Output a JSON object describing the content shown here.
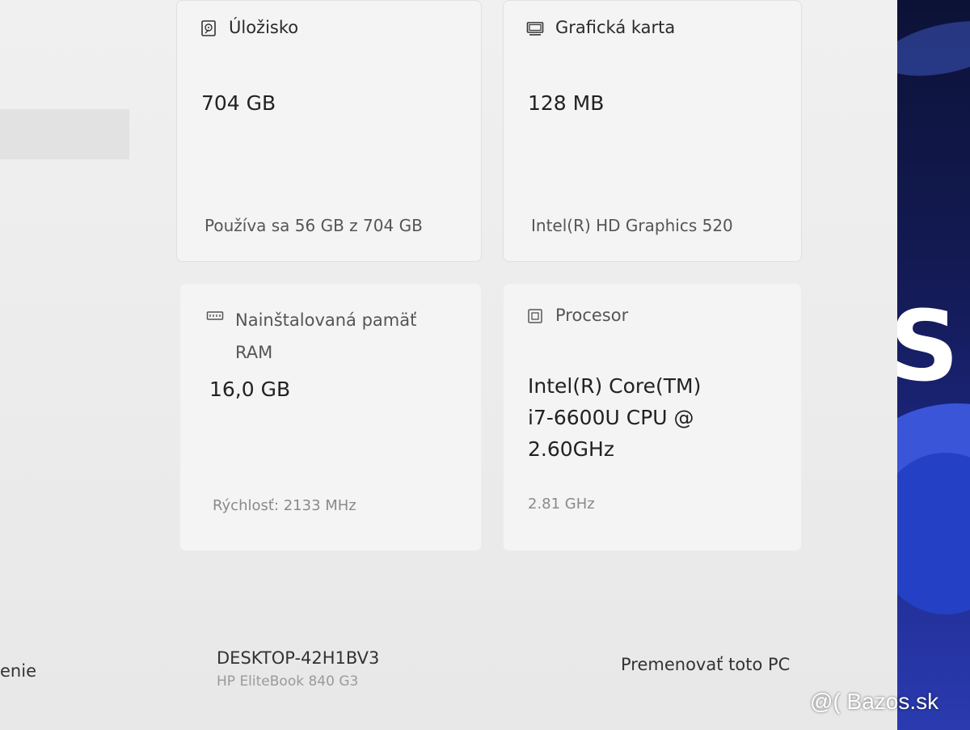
{
  "sidebar": {
    "item_partial_label": "enie"
  },
  "cards": {
    "storage": {
      "icon": "hard-drive-icon",
      "title": "Úložisko",
      "value": "704 GB",
      "detail": "Používa sa 56 GB z 704 GB"
    },
    "gpu": {
      "icon": "display-adapter-icon",
      "title": "Grafická karta",
      "value": "128 MB",
      "detail": "Intel(R) HD Graphics 520"
    },
    "ram": {
      "icon": "memory-module-icon",
      "title": "Nainštalovaná pamäť\nRAM",
      "value": "16,0 GB",
      "detail": "Rýchlosť: 2133 MHz"
    },
    "cpu": {
      "icon": "processor-chip-icon",
      "title": "Procesor",
      "value": "Intel(R) Core(TM)\ni7-6600U CPU @\n2.60GHz",
      "detail": "2.81 GHz"
    }
  },
  "device": {
    "name": "DESKTOP-42H1BV3",
    "model": "HP EliteBook 840 G3",
    "rename_label": "Premenovať toto PC"
  },
  "watermark": "@( Bazos.sk",
  "wallpaper_glyph": "S"
}
